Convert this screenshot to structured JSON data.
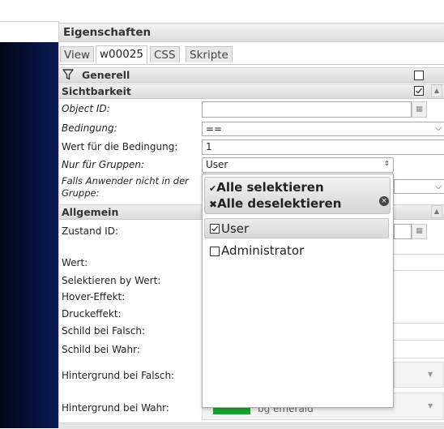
{
  "panel": {
    "title": "Eigenschaften"
  },
  "tabs": [
    {
      "label": "View"
    },
    {
      "label": "w00025"
    },
    {
      "label": "CSS"
    },
    {
      "label": "Skripte"
    }
  ],
  "sections": {
    "generell": "Generell",
    "sichtbarkeit": "Sichtbarkeit",
    "allgemein": "Allgemein"
  },
  "fields": {
    "object_id": {
      "label": "Object ID:",
      "value": ""
    },
    "bedingung": {
      "label": "Bedingung:",
      "value": "=="
    },
    "wert_bedingung": {
      "label": "Wert für die Bedingung:",
      "value": "1"
    },
    "nur_gruppen": {
      "label": "Nur für Gruppen:",
      "value": "User"
    },
    "falls_anwender": {
      "label_line1": "Falls Anwender nicht in der",
      "label_line2": "Gruppe:"
    },
    "zustand_id": {
      "label": "Zustand ID:"
    },
    "wert": {
      "label": "Wert:"
    },
    "selektieren": {
      "label": "Selektieren by Wert:"
    },
    "hover": {
      "label": "Hover-Effekt:"
    },
    "druck": {
      "label": "Druckeffekt:"
    },
    "schild_falsch": {
      "label": "Schild bei Falsch:"
    },
    "schild_wahr": {
      "label": "Schild bei Wahr:"
    },
    "hg_falsch": {
      "label": "Hintergrund bei Falsch:"
    },
    "hg_wahr": {
      "label": "Hintergrund bei Wahr:",
      "value": "bg emerald",
      "swatch_color": "#18a52c"
    }
  },
  "dropdown": {
    "select_all": "Alle selektieren",
    "deselect_all": "Alle deselektieren",
    "options": [
      {
        "label": "User",
        "checked": true
      },
      {
        "label": "Administrator",
        "checked": false
      }
    ]
  },
  "icons": {
    "generell": "filter-icon",
    "dropdown_close": "close-circle-icon"
  }
}
